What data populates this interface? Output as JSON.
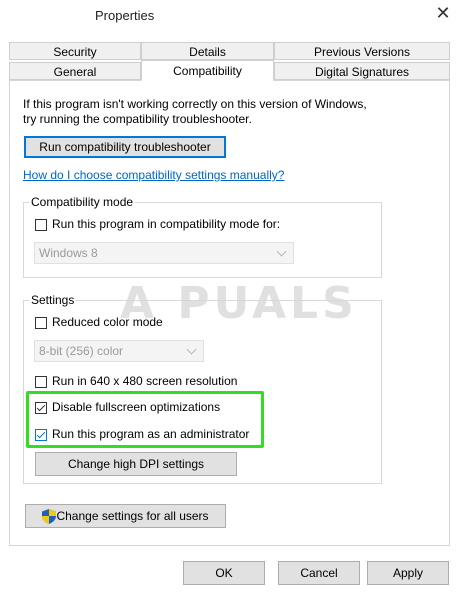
{
  "window": {
    "title": "Properties",
    "close_symbol": "✕"
  },
  "tabs": {
    "row1": [
      "Security",
      "Details",
      "Previous Versions"
    ],
    "row2": [
      "General",
      "Compatibility",
      "Digital Signatures"
    ],
    "active": "Compatibility"
  },
  "intro": {
    "line1": "If this program isn't working correctly on this version of Windows,",
    "line2": "try running the compatibility troubleshooter."
  },
  "buttons": {
    "troubleshooter": "Run compatibility troubleshooter",
    "change_dpi": "Change high DPI settings",
    "change_all_users": "Change settings for all users",
    "ok": "OK",
    "cancel": "Cancel",
    "apply": "Apply"
  },
  "link": "How do I choose compatibility settings manually?",
  "compat_mode": {
    "legend": "Compatibility mode",
    "checkbox_label": "Run this program in compatibility mode for:",
    "checked": false,
    "select_value": "Windows 8"
  },
  "settings": {
    "legend": "Settings",
    "reduced_color": {
      "label": "Reduced color mode",
      "checked": false
    },
    "color_select_value": "8-bit (256) color",
    "run_640": {
      "label": "Run in 640 x 480 screen resolution",
      "checked": false
    },
    "disable_fullscreen": {
      "label": "Disable fullscreen optimizations",
      "checked": true
    },
    "run_admin": {
      "label": "Run this program as an administrator",
      "checked": true
    }
  },
  "watermark": "A PUALS",
  "colors": {
    "highlight": "#33dd22",
    "link": "#0066cc",
    "accent": "#0078d7"
  }
}
